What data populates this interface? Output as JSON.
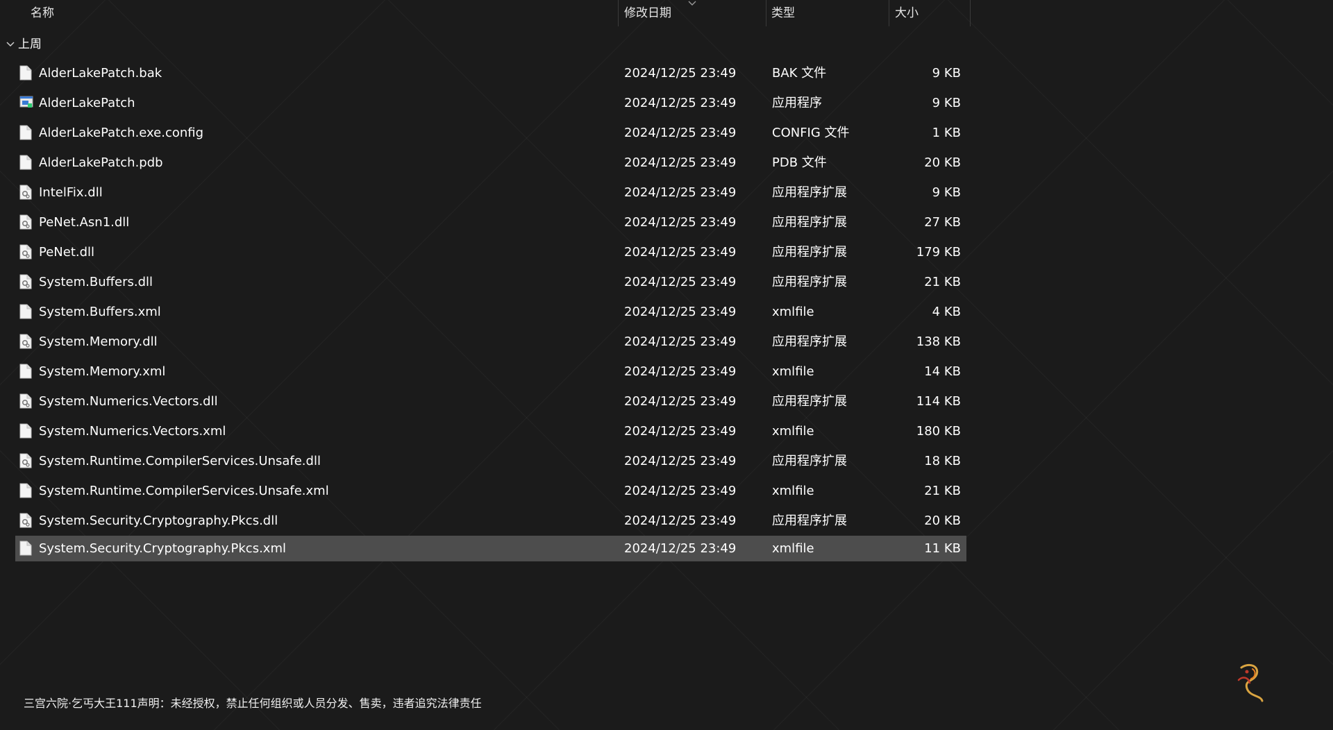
{
  "columns": {
    "name": "名称",
    "date": "修改日期",
    "type": "类型",
    "size": "大小"
  },
  "group": {
    "label": "上周"
  },
  "files": [
    {
      "name": "AlderLakePatch.bak",
      "date": "2024/12/25 23:49",
      "type": "BAK 文件",
      "size": "9 KB",
      "icon": "file-icon"
    },
    {
      "name": "AlderLakePatch",
      "date": "2024/12/25 23:49",
      "type": "应用程序",
      "size": "9 KB",
      "icon": "application-icon"
    },
    {
      "name": "AlderLakePatch.exe.config",
      "date": "2024/12/25 23:49",
      "type": "CONFIG 文件",
      "size": "1 KB",
      "icon": "file-icon"
    },
    {
      "name": "AlderLakePatch.pdb",
      "date": "2024/12/25 23:49",
      "type": "PDB 文件",
      "size": "20 KB",
      "icon": "file-icon"
    },
    {
      "name": "IntelFix.dll",
      "date": "2024/12/25 23:49",
      "type": "应用程序扩展",
      "size": "9 KB",
      "icon": "dll-file-icon"
    },
    {
      "name": "PeNet.Asn1.dll",
      "date": "2024/12/25 23:49",
      "type": "应用程序扩展",
      "size": "27 KB",
      "icon": "dll-file-icon"
    },
    {
      "name": "PeNet.dll",
      "date": "2024/12/25 23:49",
      "type": "应用程序扩展",
      "size": "179 KB",
      "icon": "dll-file-icon"
    },
    {
      "name": "System.Buffers.dll",
      "date": "2024/12/25 23:49",
      "type": "应用程序扩展",
      "size": "21 KB",
      "icon": "dll-file-icon"
    },
    {
      "name": "System.Buffers.xml",
      "date": "2024/12/25 23:49",
      "type": "xmlfile",
      "size": "4 KB",
      "icon": "file-icon"
    },
    {
      "name": "System.Memory.dll",
      "date": "2024/12/25 23:49",
      "type": "应用程序扩展",
      "size": "138 KB",
      "icon": "dll-file-icon"
    },
    {
      "name": "System.Memory.xml",
      "date": "2024/12/25 23:49",
      "type": "xmlfile",
      "size": "14 KB",
      "icon": "file-icon"
    },
    {
      "name": "System.Numerics.Vectors.dll",
      "date": "2024/12/25 23:49",
      "type": "应用程序扩展",
      "size": "114 KB",
      "icon": "dll-file-icon"
    },
    {
      "name": "System.Numerics.Vectors.xml",
      "date": "2024/12/25 23:49",
      "type": "xmlfile",
      "size": "180 KB",
      "icon": "file-icon"
    },
    {
      "name": "System.Runtime.CompilerServices.Unsafe.dll",
      "date": "2024/12/25 23:49",
      "type": "应用程序扩展",
      "size": "18 KB",
      "icon": "dll-file-icon"
    },
    {
      "name": "System.Runtime.CompilerServices.Unsafe.xml",
      "date": "2024/12/25 23:49",
      "type": "xmlfile",
      "size": "21 KB",
      "icon": "file-icon"
    },
    {
      "name": "System.Security.Cryptography.Pkcs.dll",
      "date": "2024/12/25 23:49",
      "type": "应用程序扩展",
      "size": "20 KB",
      "icon": "dll-file-icon"
    },
    {
      "name": "System.Security.Cryptography.Pkcs.xml",
      "date": "2024/12/25 23:49",
      "type": "xmlfile",
      "size": "11 KB",
      "icon": "file-icon",
      "selected": true
    }
  ],
  "notice": {
    "text": "三宫六院·乞丐大王111声明：未经授权，禁止任何组织或人员分发、售卖，违者追究法律责任"
  },
  "colors": {
    "background": "#1b1b1b",
    "selected_row": "#4d4d4d",
    "text": "#ffffff",
    "separator": "#3a3a3a"
  }
}
